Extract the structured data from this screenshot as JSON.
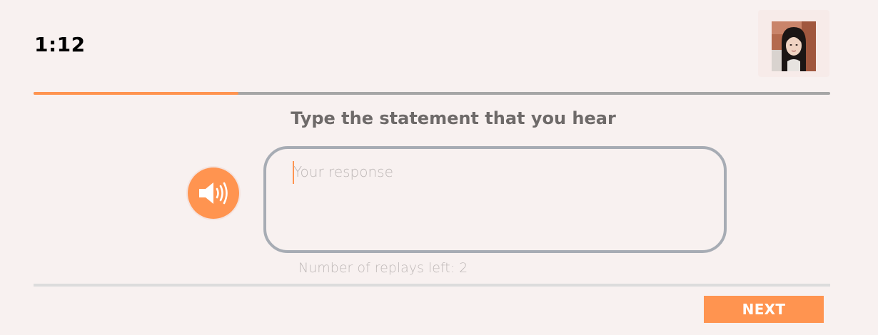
{
  "header": {
    "timer": "1:12",
    "avatar_icon": "user-photo"
  },
  "progress": {
    "fraction": 0.257,
    "fill_color": "#ff9450",
    "track_color": "#a6a6a6"
  },
  "question": {
    "prompt": "Type the statement that you hear"
  },
  "audio": {
    "icon": "speaker-volume-icon",
    "replays_text": "Number of replays left: 2"
  },
  "response": {
    "placeholder": "Your response",
    "value": ""
  },
  "footer": {
    "next_label": "NEXT"
  },
  "colors": {
    "accent": "#ff9450",
    "background": "#f8f1f0",
    "border": "#a7acb4"
  }
}
